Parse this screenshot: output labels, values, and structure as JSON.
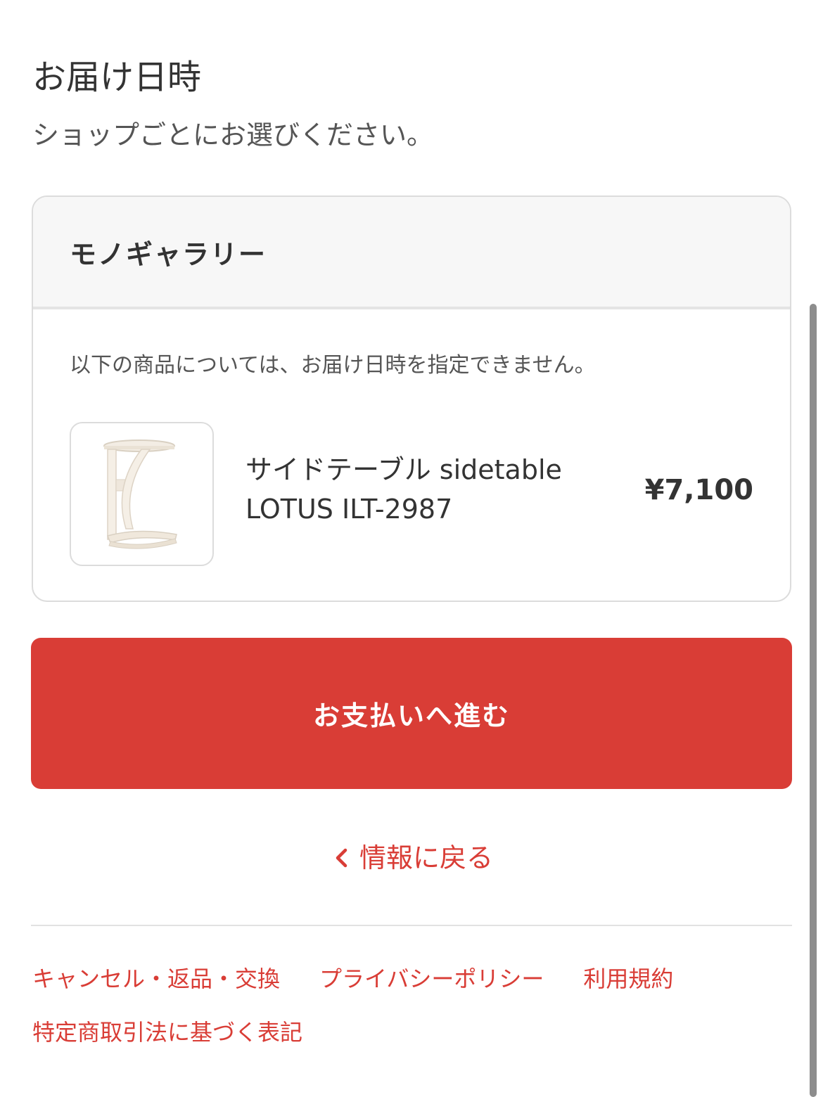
{
  "page": {
    "title": "お届け日時",
    "subtitle": "ショップごとにお選びください。"
  },
  "shop": {
    "name": "モノギャラリー",
    "notice": "以下の商品については、お届け日時を指定できません。",
    "item": {
      "name_line1": "サイドテーブル sidetable",
      "name_line2": "LOTUS ILT-2987",
      "price": "¥7,100",
      "thumbnail_icon": "side-table-product-image"
    }
  },
  "actions": {
    "pay_label": "お支払いへ進む",
    "back_label": "情報に戻る"
  },
  "footer": {
    "links": [
      "キャンセル・返品・交換",
      "プライバシーポリシー",
      "利用規約",
      "特定商取引法に基づく表記"
    ]
  },
  "colors": {
    "accent": "#d93d36",
    "text": "#333333",
    "muted": "#555555",
    "border": "#dcdcdc",
    "header_bg": "#f7f7f7"
  }
}
